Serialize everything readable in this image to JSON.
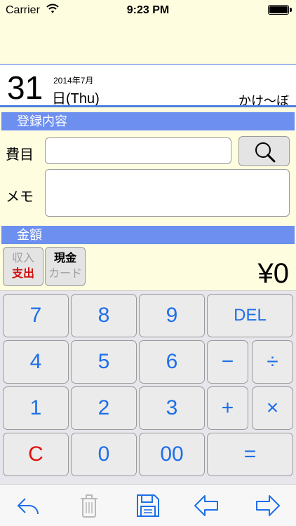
{
  "status_bar": {
    "carrier": "Carrier",
    "time": "9:23 PM"
  },
  "header": {
    "day": "31",
    "year_month": "2014年7月",
    "weekday": "日(Thu)",
    "app_name": "かけ〜ぼ"
  },
  "entry": {
    "section_title": "登録内容",
    "expense_label": "費目",
    "expense_value": "",
    "memo_label": "メモ",
    "memo_value": ""
  },
  "amount": {
    "section_title": "金額",
    "income_label": "収入",
    "expense_label": "支出",
    "cash_label": "現金",
    "card_label": "カード",
    "value": "¥0"
  },
  "keypad": {
    "k7": "7",
    "k8": "8",
    "k9": "9",
    "del": "DEL",
    "k4": "4",
    "k5": "5",
    "k6": "6",
    "minus": "−",
    "divide": "÷",
    "k1": "1",
    "k2": "2",
    "k3": "3",
    "plus": "+",
    "multiply": "×",
    "clear": "C",
    "k0": "0",
    "k00": "00",
    "equals": "="
  },
  "toolbar": {
    "icons": [
      "undo-icon",
      "trash-icon",
      "save-icon",
      "prev-icon",
      "next-icon"
    ],
    "accent": "#1e6fe8",
    "disabled": "#b8b8b8"
  }
}
